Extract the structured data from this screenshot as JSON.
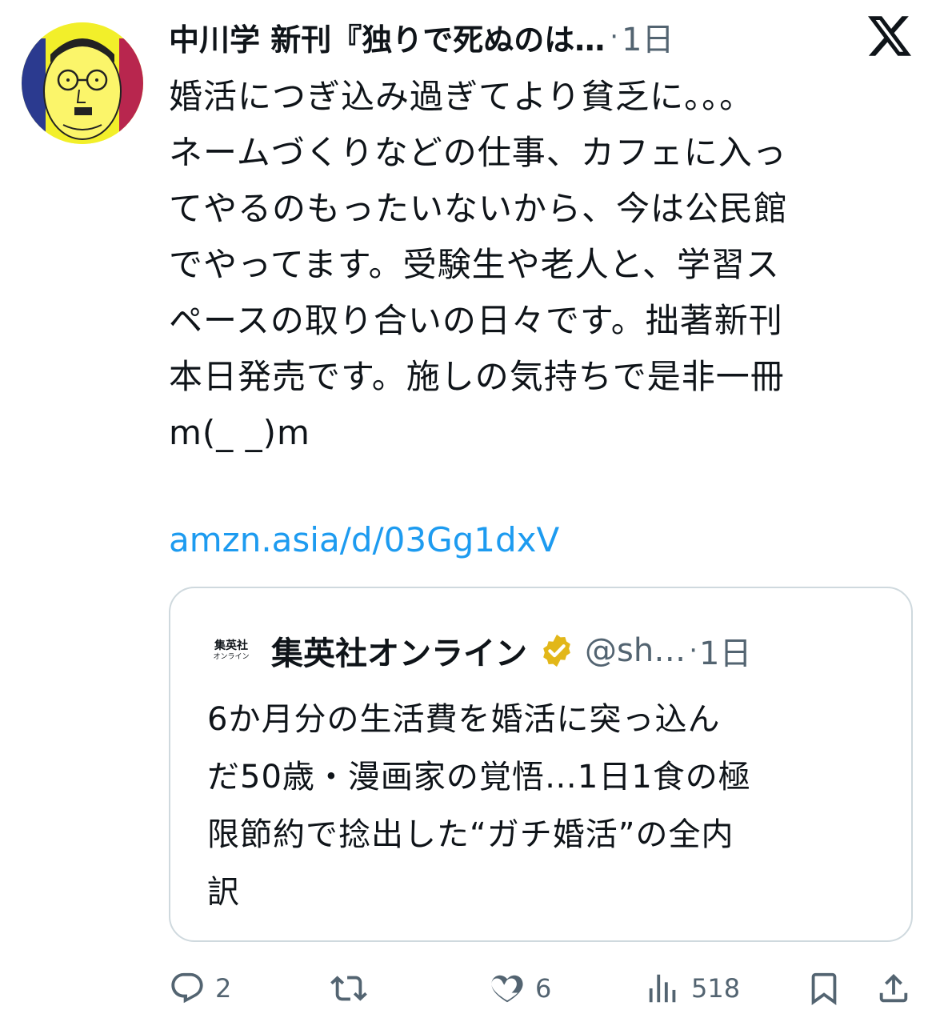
{
  "author": {
    "name": "中川学 新刊『独りで死ぬのは…",
    "time": "1日",
    "separator": "·"
  },
  "icons": {
    "avatar": "author-avatar-illustration",
    "platform": "x-logo-icon",
    "verified": "verified-gold-badge-icon",
    "reply": "reply-icon",
    "retweet": "retweet-icon",
    "like": "heart-icon",
    "views": "views-chart-icon",
    "bookmark": "bookmark-icon",
    "share": "share-icon"
  },
  "post": {
    "lines": [
      "婚活につぎ込み過ぎてより貧乏に。。。",
      "ネームづくりなどの仕事、カフェに入っ",
      "てやるのもったいないから、今は公民館",
      "でやってます。受験生や老人と、学習ス",
      "ペースの取り合いの日々です。拙著新刊",
      "本日発売です。施しの気持ちで是非一冊",
      "m(_ _)m"
    ],
    "link": "amzn.asia/d/03Gg1dxV"
  },
  "quote": {
    "logo_top": "集英社",
    "logo_bottom": "オンライン",
    "name": "集英社オンライン",
    "handle": "@sh…",
    "separator": "·",
    "time": "1日",
    "lines": [
      "6か月分の生活費を婚活に突っ込ん",
      "だ50歳・漫画家の覚悟…1日1食の極",
      "限節約で捻出した“ガチ婚活”の全内",
      "訳"
    ]
  },
  "actions": {
    "reply_count": "2",
    "retweet_count": "",
    "like_count": "6",
    "views_count": "518"
  },
  "colors": {
    "text": "#0f1419",
    "secondary": "#536471",
    "link": "#1d9bf0",
    "border": "#cfd9de",
    "verified_gold": "#e2b719"
  }
}
